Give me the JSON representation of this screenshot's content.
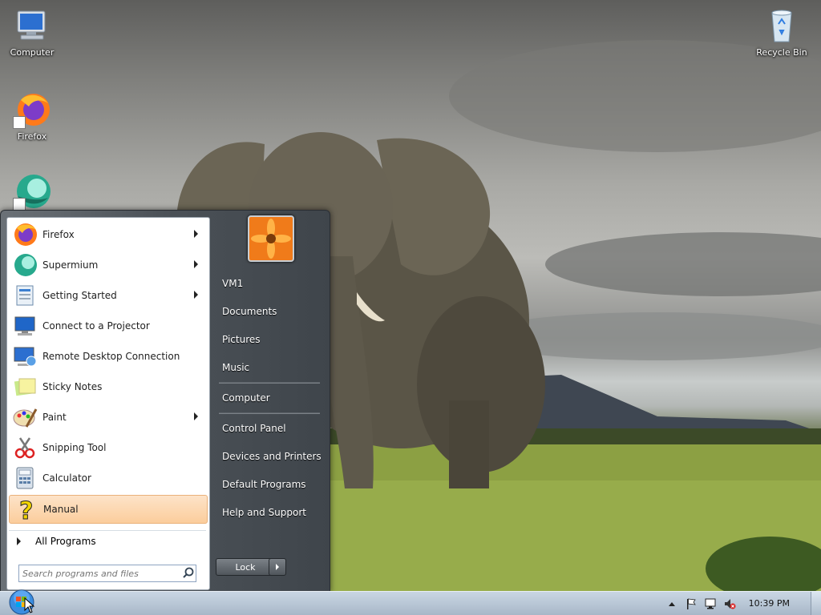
{
  "desktop": {
    "icons": [
      {
        "label": "Computer",
        "icon": "computer-icon"
      },
      {
        "label": "Firefox",
        "icon": "firefox-icon"
      },
      {
        "label": "",
        "icon": "supermium-icon"
      },
      {
        "label": "Recycle Bin",
        "icon": "recycle-bin-icon"
      }
    ]
  },
  "start_menu": {
    "programs": [
      {
        "label": "Firefox",
        "icon": "firefox-icon",
        "submenu": true
      },
      {
        "label": "Supermium",
        "icon": "supermium-icon",
        "submenu": true
      },
      {
        "label": "Getting Started",
        "icon": "getting-started-icon",
        "submenu": true
      },
      {
        "label": "Connect to a Projector",
        "icon": "projector-icon",
        "submenu": false
      },
      {
        "label": "Remote Desktop Connection",
        "icon": "remote-desktop-icon",
        "submenu": false
      },
      {
        "label": "Sticky Notes",
        "icon": "sticky-notes-icon",
        "submenu": false
      },
      {
        "label": "Paint",
        "icon": "paint-icon",
        "submenu": true
      },
      {
        "label": "Snipping Tool",
        "icon": "snipping-tool-icon",
        "submenu": false
      },
      {
        "label": "Calculator",
        "icon": "calculator-icon",
        "submenu": false
      },
      {
        "label": "Manual",
        "icon": "help-icon",
        "submenu": false,
        "highlighted": true
      }
    ],
    "all_programs": "All Programs",
    "search_placeholder": "Search programs and files",
    "places": [
      {
        "label": "VM1"
      },
      {
        "label": "Documents"
      },
      {
        "label": "Pictures"
      },
      {
        "label": "Music"
      },
      {
        "label": "Computer"
      },
      {
        "label": "Control Panel"
      },
      {
        "label": "Devices and Printers"
      },
      {
        "label": "Default Programs"
      },
      {
        "label": "Help and Support"
      }
    ],
    "lock_label": "Lock"
  },
  "taskbar": {
    "clock": "10:39 PM",
    "tray_icons": [
      "show-hidden-icon",
      "action-center-flag-icon",
      "network-disconnected-icon",
      "volume-muted-icon"
    ]
  },
  "colors": {
    "highlight": "#fbcd9c",
    "menu_dark": "#4b5157",
    "taskbar": "#b9c7d6"
  }
}
